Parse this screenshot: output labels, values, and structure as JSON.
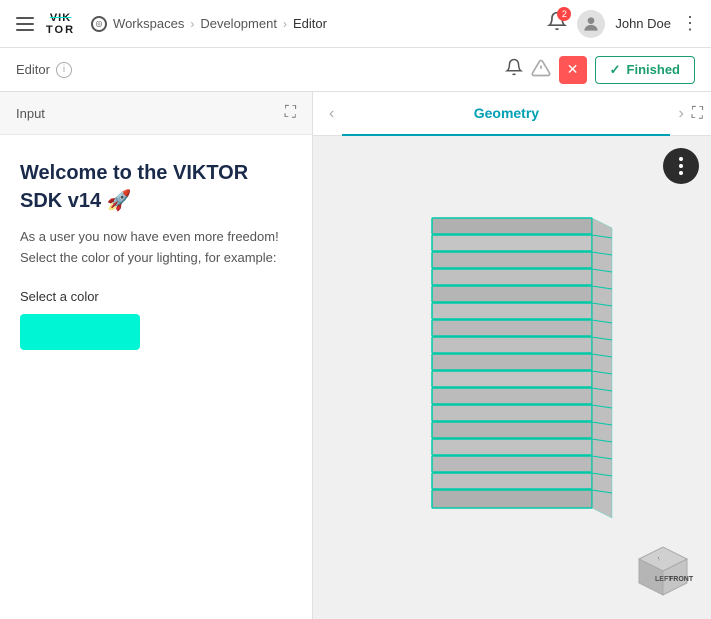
{
  "topnav": {
    "logo_top": "VIK",
    "logo_bot": "TOR",
    "workspaces_label": "Workspaces",
    "breadcrumb_development": "Development",
    "breadcrumb_editor": "Editor",
    "notification_count": "2",
    "user_name": "John Doe"
  },
  "editor_bar": {
    "label": "Editor",
    "finished_label": "Finished"
  },
  "left_panel": {
    "input_label": "Input",
    "welcome_title": "Welcome to the VIKTOR SDK v14 🚀",
    "welcome_desc": "As a user you now have even more freedom! Select the color of your lighting, for example:",
    "color_label": "Select a color",
    "color_value": "#00f5d4"
  },
  "right_panel": {
    "tab_label": "Geometry"
  },
  "icons": {
    "hamburger": "☰",
    "chevron": "›",
    "bell": "🔔",
    "close": "✕",
    "check": "✓",
    "expand": "⛶",
    "more_vert": "⋮",
    "nav_prev": "‹",
    "nav_next": "›",
    "info": "i"
  }
}
